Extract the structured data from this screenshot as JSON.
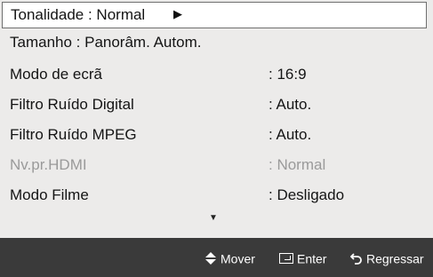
{
  "menu": {
    "selected": {
      "label": "Tonalidade",
      "value": "Normal",
      "arrow": "▶"
    },
    "tamanho": {
      "text": "Tamanho  : Panorâm. Autom."
    },
    "items": [
      {
        "label": "Modo de ecrã",
        "value": ": 16:9",
        "disabled": false
      },
      {
        "label": "Filtro Ruído Digital",
        "value": ": Auto.",
        "disabled": false
      },
      {
        "label": "Filtro Ruído MPEG",
        "value": ": Auto.",
        "disabled": false
      },
      {
        "label": "Nv.pr.HDMI",
        "value": ": Normal",
        "disabled": true
      },
      {
        "label": "Modo Filme",
        "value": ": Desligado",
        "disabled": false
      }
    ],
    "more_indicator": "▼"
  },
  "nav": {
    "mover": {
      "icon": "up-down-diamond-icon",
      "label": "Mover"
    },
    "enter": {
      "icon": "enter-icon",
      "label": "Enter"
    },
    "regressar": {
      "icon": "return-arrow-icon",
      "label": "Regressar"
    }
  }
}
